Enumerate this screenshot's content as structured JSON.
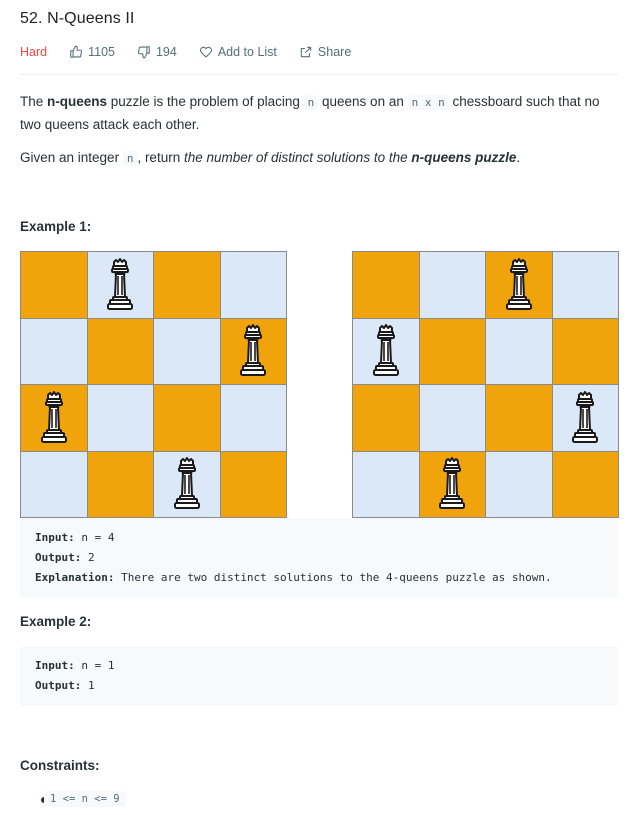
{
  "problem": {
    "title": "52. N-Queens II",
    "difficulty": "Hard",
    "likes": "1105",
    "dislikes": "194",
    "add_to_list": "Add to List",
    "share": "Share"
  },
  "description": {
    "p1_a": "The ",
    "p1_bold": "n-queens",
    "p1_b": " puzzle is the problem of placing ",
    "p1_code1": "n",
    "p1_c": " queens on an ",
    "p1_code2": "n x n",
    "p1_d": " chessboard such that no two queens attack each other.",
    "p2_a": "Given an integer ",
    "p2_code": "n",
    "p2_b": ", return ",
    "p2_em": "the number of distinct solutions to the ",
    "p2_em_bold": "n-queens puzzle",
    "p2_c": "."
  },
  "example1": {
    "heading": "Example 1:",
    "input_label": "Input:",
    "input_value": " n = 4",
    "output_label": "Output:",
    "output_value": " 2",
    "explanation_label": "Explanation:",
    "explanation_value": " There are two distinct solutions to the 4-queens puzzle as shown.",
    "boards": [
      [
        1,
        3,
        0,
        2
      ],
      [
        2,
        0,
        3,
        1
      ]
    ]
  },
  "example2": {
    "heading": "Example 2:",
    "input_label": "Input:",
    "input_value": " n = 1",
    "output_label": "Output:",
    "output_value": " 1"
  },
  "constraints": {
    "heading": "Constraints:",
    "items": [
      "1 <= n <= 9"
    ]
  },
  "colors": {
    "dark_square": "#f0a30a",
    "light_square": "#dbe8f7",
    "difficulty_hard": "#ef4743"
  }
}
